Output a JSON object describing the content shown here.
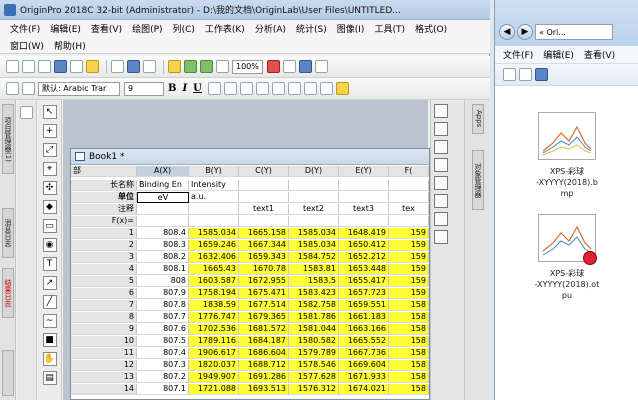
{
  "origin": {
    "title": "OriginPro 2018C 32-bit (Administrator) - D:\\我的文档\\OriginLab\\User Files\\UNTITLED...",
    "menu_row1": [
      "文件(F)",
      "编辑(E)",
      "查看(V)",
      "绘图(P)",
      "列(C)",
      "工作表(K)",
      "分析(A)",
      "统计(S)",
      "图像(I)",
      "工具(T)",
      "格式(O)"
    ],
    "menu_row2": [
      "窗口(W)",
      "帮助(H)"
    ],
    "zoom": "100%",
    "font_label": "默认: Arabic Trar",
    "font_size": "9",
    "fmt_bold": "B",
    "fmt_italic": "I",
    "fmt_underline": "U",
    "left_tabs": [
      "项目管理器(1)",
      "消息日志",
      "结果日志"
    ],
    "right_tab": "对象管理器",
    "apps_tab": "Apps"
  },
  "book": {
    "title": "Book1 *",
    "corner_label": "部",
    "columns": [
      "A(X)",
      "B(Y)",
      "C(Y)",
      "D(Y)",
      "E(Y)",
      "F("
    ],
    "meta_rows": [
      {
        "label": "长名称",
        "cells": [
          "Binding En",
          "Intensity",
          "",
          "",
          "",
          ""
        ]
      },
      {
        "label": "单位",
        "cells": [
          "eV",
          "a.u.",
          "",
          "",
          "",
          ""
        ]
      },
      {
        "label": "注释",
        "cells": [
          "",
          "",
          "text1",
          "text2",
          "text3",
          "tex"
        ]
      },
      {
        "label": "F(x)=",
        "cells": [
          "",
          "",
          "",
          "",
          "",
          ""
        ]
      }
    ],
    "rows": [
      {
        "n": "1",
        "cells": [
          "808.4",
          "1585.034",
          "1665.158",
          "1585.034",
          "1648.419",
          "159"
        ]
      },
      {
        "n": "2",
        "cells": [
          "808.3",
          "1659.246",
          "1667.344",
          "1585.034",
          "1650.412",
          "159"
        ]
      },
      {
        "n": "3",
        "cells": [
          "808.2",
          "1632.406",
          "1659.343",
          "1584.752",
          "1652.212",
          "159"
        ]
      },
      {
        "n": "4",
        "cells": [
          "808.1",
          "1665.43",
          "1670.78",
          "1583.81",
          "1653.448",
          "159"
        ]
      },
      {
        "n": "5",
        "cells": [
          "808",
          "1603.587",
          "1672.955",
          "1583.5",
          "1655.417",
          "159"
        ]
      },
      {
        "n": "6",
        "cells": [
          "807.9",
          "1758.194",
          "1675.471",
          "1583.423",
          "1657.723",
          "159"
        ]
      },
      {
        "n": "7",
        "cells": [
          "807.8",
          "1838.59",
          "1677.514",
          "1582.758",
          "1659.551",
          "158"
        ]
      },
      {
        "n": "8",
        "cells": [
          "807.7",
          "1776.747",
          "1679.365",
          "1581.786",
          "1661.183",
          "158"
        ]
      },
      {
        "n": "9",
        "cells": [
          "807.6",
          "1702.536",
          "1681.572",
          "1581.044",
          "1663.166",
          "158"
        ]
      },
      {
        "n": "10",
        "cells": [
          "807.5",
          "1789.116",
          "1684.187",
          "1580.582",
          "1665.552",
          "158"
        ]
      },
      {
        "n": "11",
        "cells": [
          "807.4",
          "1906.617",
          "1686.604",
          "1579.789",
          "1667.736",
          "158"
        ]
      },
      {
        "n": "12",
        "cells": [
          "807.3",
          "1820.037",
          "1688.712",
          "1578.546",
          "1669.604",
          "158"
        ]
      },
      {
        "n": "13",
        "cells": [
          "807.2",
          "1949.907",
          "1691.286",
          "1577.628",
          "1671.933",
          "158"
        ]
      },
      {
        "n": "14",
        "cells": [
          "807.1",
          "1721.088",
          "1693.513",
          "1576.312",
          "1674.021",
          "158"
        ]
      }
    ]
  },
  "explorer": {
    "address": "« Ori...",
    "menu": [
      "文件(F)",
      "编辑(E)",
      "查看(V)"
    ],
    "files": [
      {
        "name_line1": "XPS-彩球",
        "name_line2": "-XYYYY(2018).b",
        "name_line3": "mp"
      },
      {
        "name_line1": "XPS-彩球",
        "name_line2": "-XYYYY(2018).ot",
        "name_line3": "pu"
      }
    ]
  },
  "colors": {
    "selected_col": "#ffff33",
    "header": "#e4e4e4"
  }
}
